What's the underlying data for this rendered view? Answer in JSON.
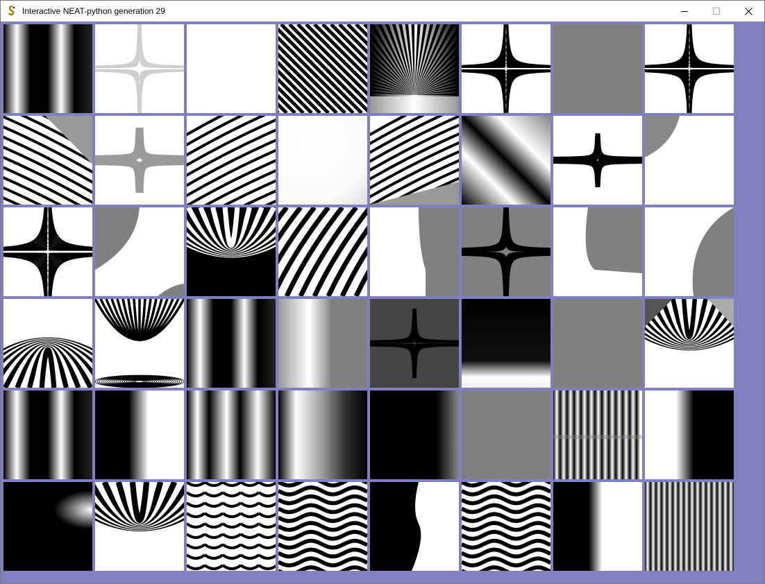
{
  "window": {
    "title": "Interactive NEAT-python generation 29",
    "icon": "pygame-snake-icon",
    "controls": [
      "minimize-icon",
      "maximize-icon",
      "close-icon"
    ]
  },
  "colors": {
    "background": "#8080c0",
    "titlebar": "#ffffff",
    "pattern_dark": "#000000",
    "pattern_light": "#ffffff",
    "pattern_gray": "#808080"
  },
  "grid": {
    "rows": 6,
    "columns": 8,
    "genomes": [
      {
        "kind": "vstripe-wide"
      },
      {
        "kind": "cross-light"
      },
      {
        "kind": "blank"
      },
      {
        "kind": "diag-stripes"
      },
      {
        "kind": "fan-bottom"
      },
      {
        "kind": "cross-dense"
      },
      {
        "kind": "gray"
      },
      {
        "kind": "cross-dense"
      },
      {
        "kind": "curve-stripes"
      },
      {
        "kind": "cross-gray"
      },
      {
        "kind": "hstripe-curve"
      },
      {
        "kind": "soft-white"
      },
      {
        "kind": "curve-stripes-2"
      },
      {
        "kind": "swirl-dark"
      },
      {
        "kind": "cross-strong"
      },
      {
        "kind": "corner-gray"
      },
      {
        "kind": "cross-fine"
      },
      {
        "kind": "corner-gray-2"
      },
      {
        "kind": "fan-top"
      },
      {
        "kind": "diag-bands"
      },
      {
        "kind": "corner-gray-3"
      },
      {
        "kind": "cross-open"
      },
      {
        "kind": "corner-gray-4"
      },
      {
        "kind": "corner-gray-5"
      },
      {
        "kind": "fan-top-2"
      },
      {
        "kind": "fan-center"
      },
      {
        "kind": "vstripe-wide"
      },
      {
        "kind": "gray-curve"
      },
      {
        "kind": "cross-open-2"
      },
      {
        "kind": "hgradient-dark"
      },
      {
        "kind": "gray"
      },
      {
        "kind": "fan-top-3"
      },
      {
        "kind": "vstripe-wide"
      },
      {
        "kind": "split-black-white"
      },
      {
        "kind": "vstripe-wide-2"
      },
      {
        "kind": "vstripe-soft"
      },
      {
        "kind": "dark-gradient"
      },
      {
        "kind": "gray"
      },
      {
        "kind": "vstripe-fine"
      },
      {
        "kind": "white-black"
      },
      {
        "kind": "black-glow"
      },
      {
        "kind": "fan-top-4"
      },
      {
        "kind": "wave-grid"
      },
      {
        "kind": "wave-rows"
      },
      {
        "kind": "black-white-wave"
      },
      {
        "kind": "wave-rows"
      },
      {
        "kind": "black-white-soft"
      },
      {
        "kind": "vstripe-finer"
      }
    ]
  }
}
